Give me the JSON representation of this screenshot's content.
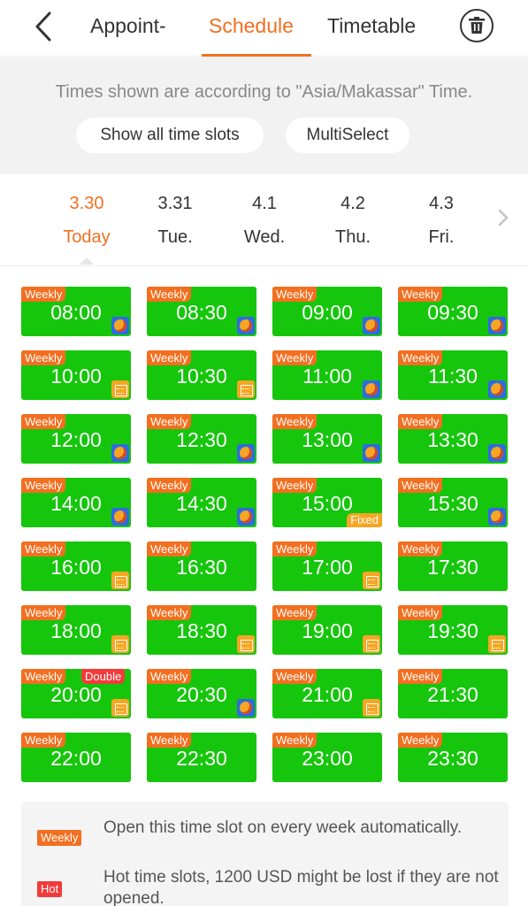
{
  "header": {
    "tabs": [
      {
        "label": "Appoint-"
      },
      {
        "label": "Schedule"
      },
      {
        "label": "Timetable"
      }
    ],
    "active_tab": "Schedule",
    "accent_color": "#f36f20"
  },
  "info": {
    "timezone_text": "Times shown are according to \"Asia/Makassar\" Time.",
    "show_all_label": "Show all time slots",
    "multiselect_label": "MultiSelect"
  },
  "dates": [
    {
      "date": "3.30",
      "weekday": "Today",
      "active": true
    },
    {
      "date": "3.31",
      "weekday": "Tue."
    },
    {
      "date": "4.1",
      "weekday": "Wed."
    },
    {
      "date": "4.2",
      "weekday": "Thu."
    },
    {
      "date": "4.3",
      "weekday": "Fri."
    }
  ],
  "slot_tag": "Weekly",
  "slots": [
    {
      "time": "08:00",
      "badge": "avatar"
    },
    {
      "time": "08:30",
      "badge": "avatar"
    },
    {
      "time": "09:00",
      "badge": "avatar"
    },
    {
      "time": "09:30",
      "badge": "avatar"
    },
    {
      "time": "10:00",
      "badge": "calendar"
    },
    {
      "time": "10:30",
      "badge": "calendar"
    },
    {
      "time": "11:00",
      "badge": "avatar"
    },
    {
      "time": "11:30",
      "badge": "avatar"
    },
    {
      "time": "12:00",
      "badge": "avatar"
    },
    {
      "time": "12:30",
      "badge": "avatar"
    },
    {
      "time": "13:00",
      "badge": "avatar"
    },
    {
      "time": "13:30",
      "badge": "avatar"
    },
    {
      "time": "14:00",
      "badge": "avatar"
    },
    {
      "time": "14:30",
      "badge": "avatar"
    },
    {
      "time": "15:00",
      "badge": "fixed",
      "fixed_label": "Fixed"
    },
    {
      "time": "15:30",
      "badge": "avatar"
    },
    {
      "time": "16:00",
      "badge": "calendar"
    },
    {
      "time": "16:30",
      "badge": "none"
    },
    {
      "time": "17:00",
      "badge": "calendar"
    },
    {
      "time": "17:30",
      "badge": "none"
    },
    {
      "time": "18:00",
      "badge": "calendar"
    },
    {
      "time": "18:30",
      "badge": "calendar"
    },
    {
      "time": "19:00",
      "badge": "calendar"
    },
    {
      "time": "19:30",
      "badge": "calendar"
    },
    {
      "time": "20:00",
      "badge": "calendar",
      "double_label": "Double"
    },
    {
      "time": "20:30",
      "badge": "avatar"
    },
    {
      "time": "21:00",
      "badge": "calendar"
    },
    {
      "time": "21:30",
      "badge": "none"
    },
    {
      "time": "22:00",
      "badge": "none"
    },
    {
      "time": "22:30",
      "badge": "none"
    },
    {
      "time": "23:00",
      "badge": "none"
    },
    {
      "time": "23:30",
      "badge": "none"
    }
  ],
  "legend": {
    "weekly_tag": "Weekly",
    "weekly_text": "Open this time slot on every week automatically.",
    "hot_tag": "Hot",
    "hot_text": "Hot time slots, 1200 USD might be lost if they are not opened."
  },
  "colors": {
    "slot_green": "#16c60c",
    "weekly_orange": "#f36f20",
    "hot_red": "#f23b3b",
    "calendar_badge": "#f5a623",
    "avatar_badge": "#2d6be0"
  }
}
